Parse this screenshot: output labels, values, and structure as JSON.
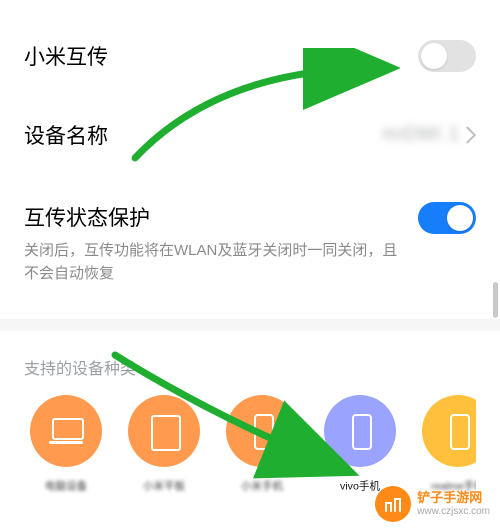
{
  "row_mishare": {
    "label": "小米互传",
    "toggle_on": false
  },
  "row_device": {
    "label": "设备名称",
    "value": "miDMI 1"
  },
  "row_protect": {
    "label": "互传状态保护",
    "desc": "关闭后，互传功能将在WLAN及蓝牙关闭时一同关闭，且不会自动恢复",
    "toggle_on": true
  },
  "supported_section": {
    "title": "支持的设备种类",
    "devices": [
      {
        "label": "电脑设备",
        "color": "orange",
        "glyph": "laptop",
        "brand": "mi",
        "blur": true
      },
      {
        "label": "小米平板",
        "color": "orange",
        "glyph": "tablet",
        "brand": "mi",
        "blur": true
      },
      {
        "label": "小米手机",
        "color": "orange",
        "glyph": "phone",
        "brand": "mi",
        "blur": true
      },
      {
        "label": "vivo手机",
        "color": "blue",
        "glyph": "phone",
        "brand": "vivo",
        "blur": false
      },
      {
        "label": "realme手机",
        "color": "yellow",
        "glyph": "phone",
        "brand": "realme",
        "blur": true
      }
    ]
  },
  "watermark": {
    "title": "铲子手游网",
    "url": "www.czjsxc.com",
    "logo_bg": "#ff8a17"
  },
  "annotation_color": "#1fae2f"
}
